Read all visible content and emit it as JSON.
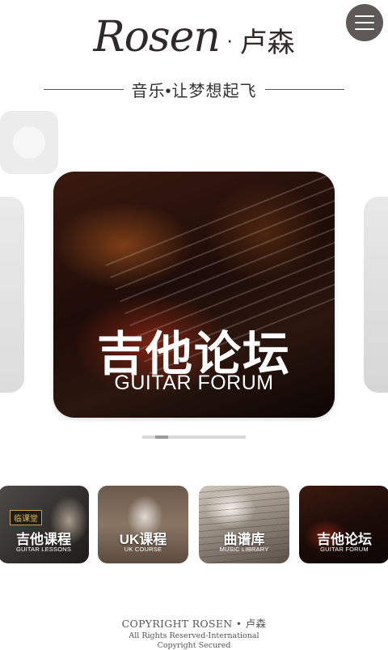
{
  "header": {
    "logo_latin": "Rosen",
    "logo_separator": "·",
    "logo_cn": "卢森",
    "slogan": "音乐•让梦想起飞"
  },
  "menu_button_icon": "hamburger-menu-icon",
  "carousel": {
    "active_card": {
      "title": "吉他论坛",
      "subtitle": "GUITAR FORUM"
    },
    "active_index": 2,
    "total": 8
  },
  "thumbnails": [
    {
      "tag": "临课堂",
      "title": "吉他课程",
      "subtitle": "GUITAR LESSONS"
    },
    {
      "title": "UK课程",
      "subtitle": "UK COURSE"
    },
    {
      "title": "曲谱库",
      "subtitle": "MUSIC LIBRARY"
    },
    {
      "title": "吉他论坛",
      "subtitle": "GUITAR FORUM"
    }
  ],
  "footer": {
    "copyright": "COPYRIGHT ROSEN • 卢森",
    "rights_line1": "All Rights Reserved-International",
    "rights_line2": "Copyright Secured"
  },
  "colors": {
    "menu_button": "#5e5856",
    "logo": "#2d2a29",
    "tag_gold": "#e3b94a"
  }
}
